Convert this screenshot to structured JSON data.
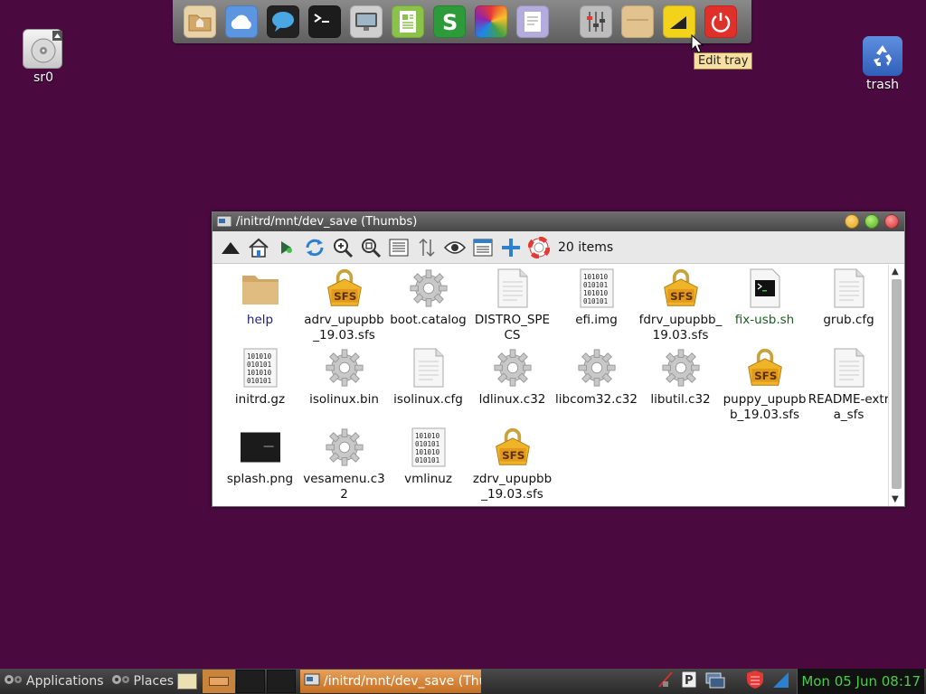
{
  "desktop": {
    "icons": [
      {
        "label": "sr0",
        "icon": "optical-drive-icon"
      },
      {
        "label": "trash",
        "icon": "recycle-icon"
      }
    ]
  },
  "dock": {
    "items": [
      {
        "name": "home-folder",
        "color": "#d9b57a"
      },
      {
        "name": "cloud",
        "color": "#6da3e8"
      },
      {
        "name": "chat",
        "color": "#4aa3df"
      },
      {
        "name": "terminal",
        "color": "#222222"
      },
      {
        "name": "monitor",
        "color": "#b8b8b8"
      },
      {
        "name": "document-writer",
        "color": "#8bc34a"
      },
      {
        "name": "spreadsheet",
        "color": "#2e9b3a"
      },
      {
        "name": "color-palette",
        "color": "#e53935"
      },
      {
        "name": "text-editor",
        "color": "#b0a8d8"
      },
      {
        "name": "mixer-settings",
        "color": "#9e9e9e"
      },
      {
        "name": "box",
        "color": "#d9b57a"
      },
      {
        "name": "edit-tray",
        "color": "#f2d21b"
      },
      {
        "name": "power",
        "color": "#e53935"
      }
    ],
    "tooltip": "Edit tray"
  },
  "window": {
    "title": "/initrd/mnt/dev_save (Thumbs)",
    "items_count": "20 items",
    "files": [
      {
        "name": "help",
        "kind": "folder"
      },
      {
        "name": "adrv_upupbb_19.03.sfs",
        "kind": "sfs"
      },
      {
        "name": "boot.catalog",
        "kind": "gear"
      },
      {
        "name": "DISTRO_SPECS",
        "kind": "doc"
      },
      {
        "name": "efi.img",
        "kind": "binary"
      },
      {
        "name": "fdrv_upupbb_19.03.sfs",
        "kind": "sfs"
      },
      {
        "name": "fix-usb.sh",
        "kind": "script"
      },
      {
        "name": "grub.cfg",
        "kind": "doc"
      },
      {
        "name": "initrd.gz",
        "kind": "binary"
      },
      {
        "name": "isolinux.bin",
        "kind": "gear"
      },
      {
        "name": "isolinux.cfg",
        "kind": "doc"
      },
      {
        "name": "ldlinux.c32",
        "kind": "gear"
      },
      {
        "name": "libcom32.c32",
        "kind": "gear"
      },
      {
        "name": "libutil.c32",
        "kind": "gear"
      },
      {
        "name": "puppy_upupbb_19.03.sfs",
        "kind": "sfs"
      },
      {
        "name": "README-extra_sfs",
        "kind": "doc"
      },
      {
        "name": "splash.png",
        "kind": "image"
      },
      {
        "name": "vesamenu.c32",
        "kind": "gear"
      },
      {
        "name": "vmlinuz",
        "kind": "binary"
      },
      {
        "name": "zdrv_upupbb_19.03.sfs",
        "kind": "sfs"
      }
    ]
  },
  "taskbar": {
    "applications_label": "Applications",
    "places_label": "Places",
    "task_title": "/initrd/mnt/dev_save (Thur",
    "clock": "Mon 05 Jun 08:17"
  }
}
